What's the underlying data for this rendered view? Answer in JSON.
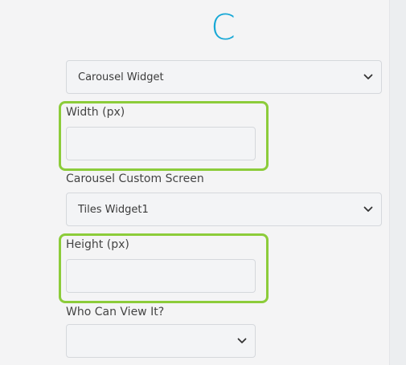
{
  "header": {
    "letter": "C"
  },
  "form": {
    "widget_select": {
      "value": "Carousel Widget",
      "icon": "chevron-down-icon"
    },
    "width_field": {
      "label": "Width (px)",
      "value": ""
    },
    "custom_screen": {
      "label": "Carousel Custom Screen",
      "value": "Tiles Widget1",
      "icon": "chevron-down-icon"
    },
    "height_field": {
      "label": "Height (px)",
      "value": ""
    },
    "visibility": {
      "label": "Who Can View It?",
      "value": "",
      "icon": "chevron-down-icon"
    }
  },
  "colors": {
    "accent": "#17a8d6",
    "highlight": "#8ccc3a",
    "field_bg": "#f3f4f6",
    "field_border": "#d5d8dc"
  }
}
